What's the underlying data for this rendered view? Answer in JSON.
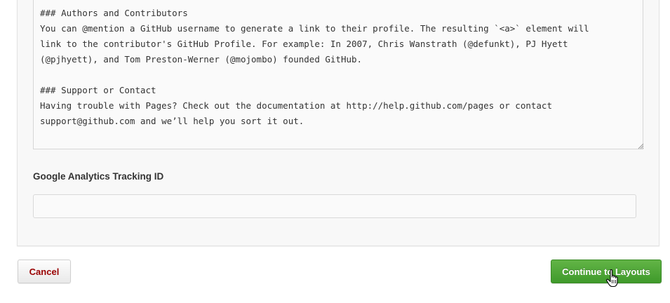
{
  "editor": {
    "body_text": "### Authors and Contributors\nYou can @mention a GitHub username to generate a link to their profile. The resulting `<a>` element will\nlink to the contributor's GitHub Profile. For example: In 2007, Chris Wanstrath (@defunkt), PJ Hyett\n(@pjhyett), and Tom Preston-Werner (@mojombo) founded GitHub.\n\n### Support or Contact\nHaving trouble with Pages? Check out the documentation at http://help.github.com/pages or contact\nsupport@github.com and we’ll help you sort it out."
  },
  "analytics": {
    "label": "Google Analytics Tracking ID",
    "value": "",
    "placeholder": ""
  },
  "actions": {
    "cancel_label": "Cancel",
    "continue_label": "Continue to Layouts"
  },
  "colors": {
    "cancel_text": "#990000",
    "continue_bg": "#4ea83a",
    "panel_bg": "#f8f8f8"
  },
  "icons": {
    "resize": "resize-grip-icon",
    "cursor": "hand-pointer-icon"
  }
}
